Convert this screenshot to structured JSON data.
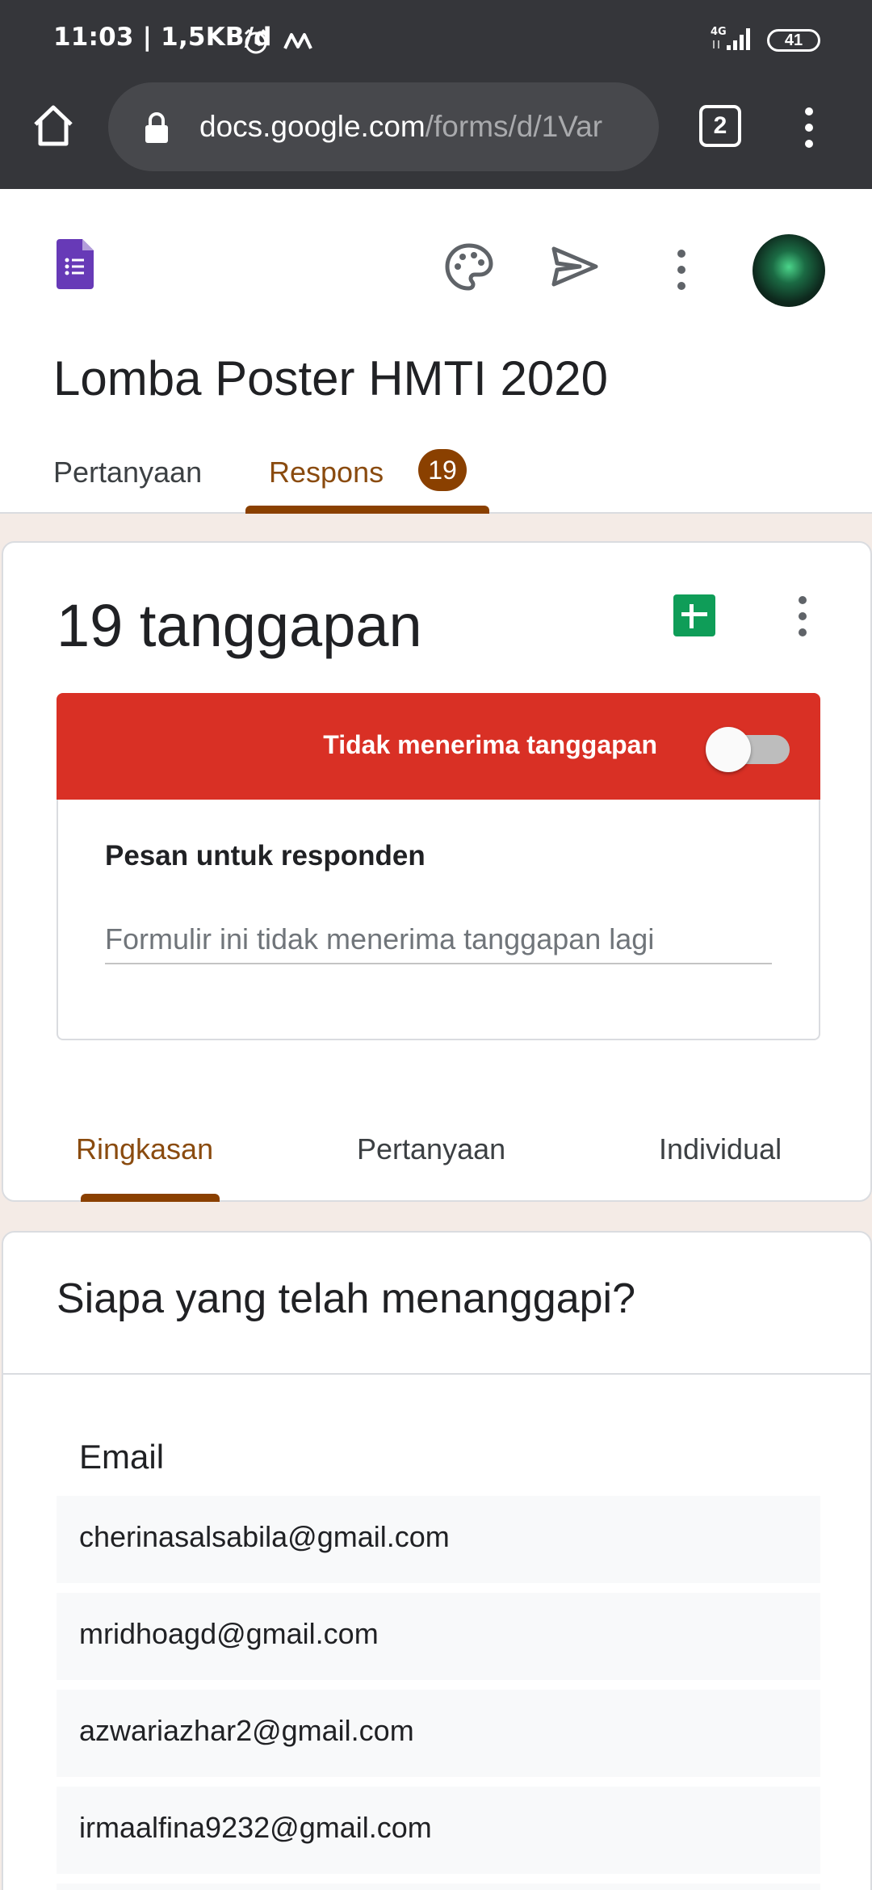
{
  "status_bar": {
    "time_speed": "11:03 | 1,5KB/d",
    "network": "4G",
    "battery": "41"
  },
  "browser": {
    "url_host": "docs.google.com",
    "url_path": "/forms/d/1Var",
    "tab_count": "2"
  },
  "form": {
    "title": "Lomba Poster HMTI 2020",
    "tabs": [
      {
        "label": "Pertanyaan"
      },
      {
        "label": "Respons",
        "badge": "19"
      }
    ]
  },
  "responses": {
    "title": "19 tanggapan",
    "banner_text": "Tidak menerima tanggapan",
    "accepting": false,
    "message_label": "Pesan untuk responden",
    "message_value": "Formulir ini tidak menerima tanggapan lagi",
    "sub_tabs": [
      {
        "label": "Ringkasan"
      },
      {
        "label": "Pertanyaan"
      },
      {
        "label": "Individual"
      }
    ]
  },
  "who": {
    "title": "Siapa yang telah menanggapi?",
    "column": "Email",
    "emails": [
      "cherinasalsabila@gmail.com",
      "mridhoagd@gmail.com",
      "azwariazhar2@gmail.com",
      "irmaalfina9232@gmail.com"
    ]
  },
  "colors": {
    "accent": "#8a4000",
    "banner": "#d93025",
    "forms_purple": "#673ab7",
    "sheets_green": "#0f9d58"
  }
}
